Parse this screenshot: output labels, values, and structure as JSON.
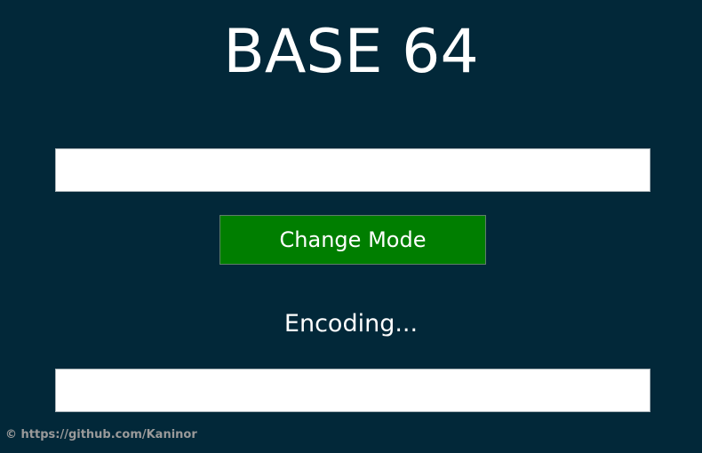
{
  "header": {
    "title": "BASE 64"
  },
  "input": {
    "value": "",
    "placeholder": ""
  },
  "controls": {
    "change_mode_label": "Change Mode",
    "button_color": "#007e00"
  },
  "status": {
    "mode_text": "Encoding..."
  },
  "output": {
    "value": "",
    "placeholder": ""
  },
  "footer": {
    "credit": "© https://github.com/Kaninor"
  },
  "theme": {
    "background": "#022839",
    "text": "#ffffff"
  }
}
